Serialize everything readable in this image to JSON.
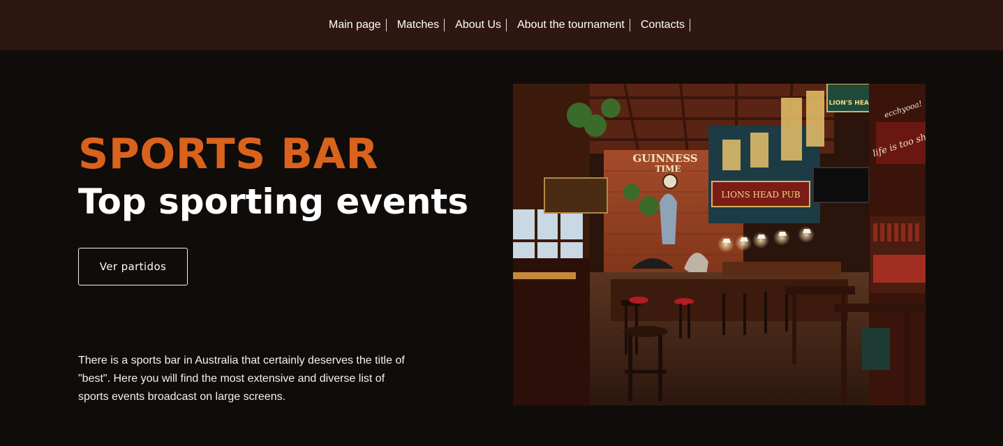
{
  "nav": {
    "items": [
      {
        "label": "Main page"
      },
      {
        "label": "Matches"
      },
      {
        "label": "About Us"
      },
      {
        "label": "About the tournament"
      },
      {
        "label": "Contacts"
      }
    ]
  },
  "hero": {
    "eyebrow": "SPORTS BAR",
    "headline": "Top sporting events",
    "cta_label": "Ver partidos",
    "description": "There is a sports bar in Australia that certainly deserves the title of \"best\". Here you will find the most extensive and diverse list of sports events broadcast on large screens."
  },
  "photo": {
    "signs": {
      "guinness": "GUINNESS",
      "time": "TIME",
      "lions_head": "LION'S HEAD",
      "pub": "LIONS HEAD PUB",
      "life": "life is too sh",
      "top_right": "ecchyooa!"
    }
  },
  "colors": {
    "nav_bg": "#2e1710",
    "page_bg": "#100c09",
    "accent": "#d9621d",
    "text": "#ffffff"
  }
}
